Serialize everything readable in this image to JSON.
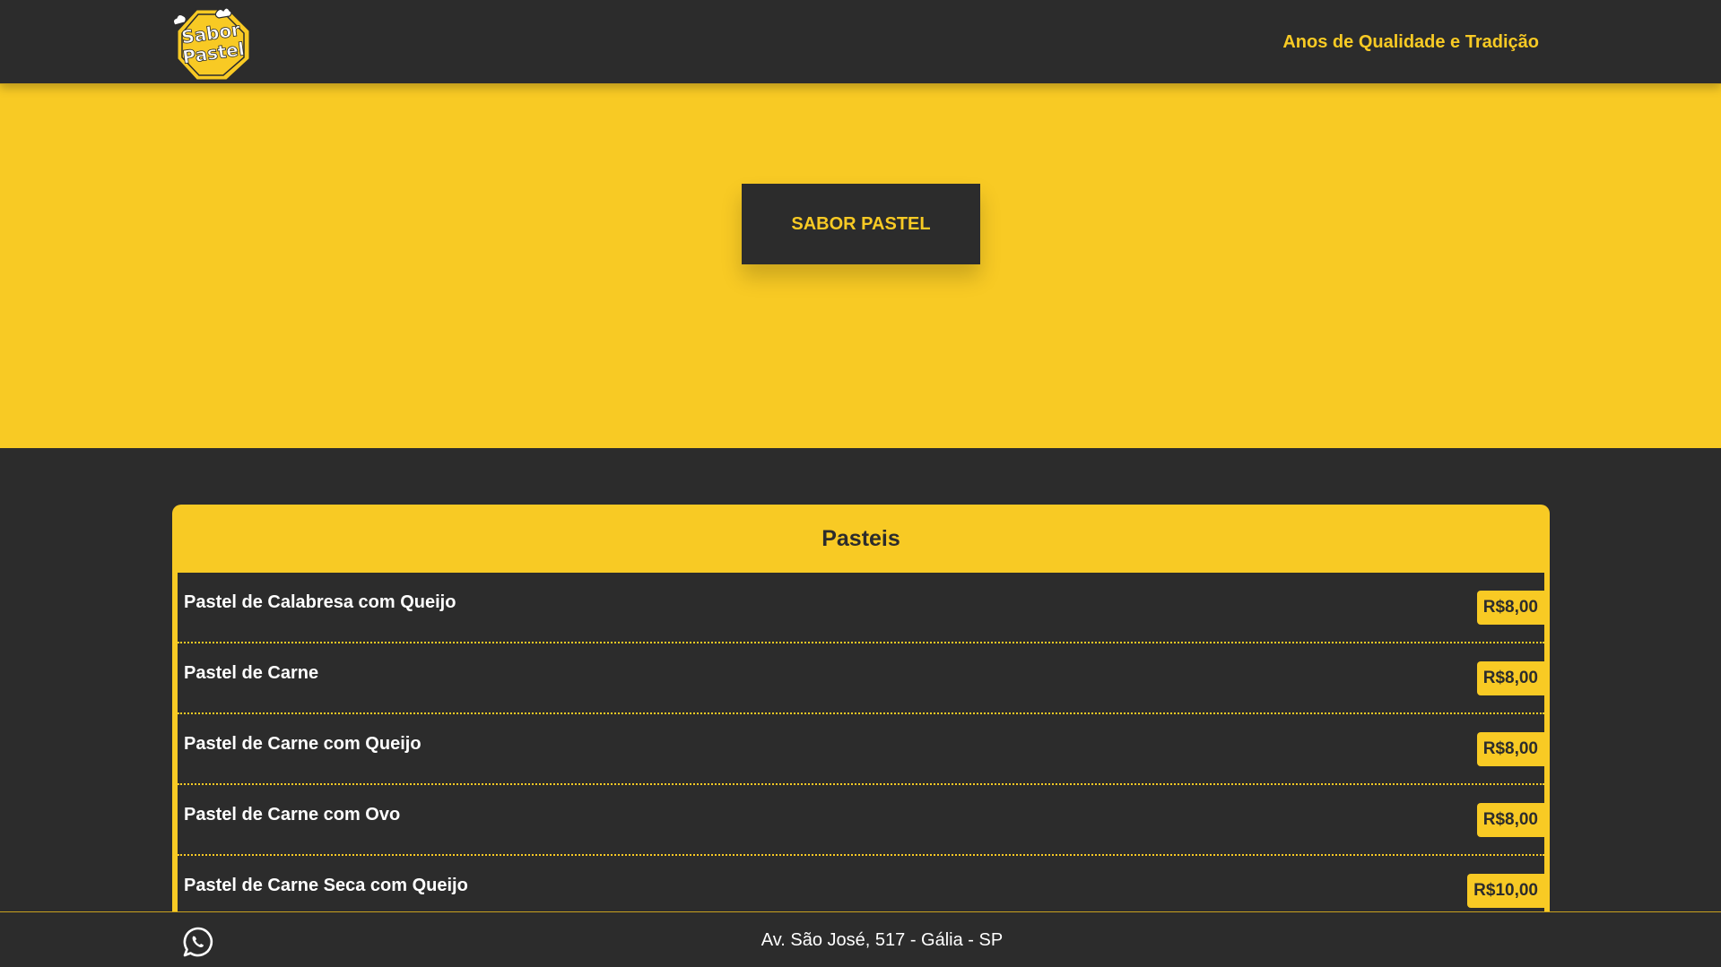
{
  "header": {
    "logo_text": [
      "Sabor",
      "Pastel"
    ],
    "tagline": "Anos de Qualidade e Tradição"
  },
  "hero": {
    "button_label": "SABOR PASTEL"
  },
  "menu": {
    "title": "Pasteis",
    "items": [
      {
        "name": "Pastel de Calabresa com Queijo",
        "price": "R$8,00"
      },
      {
        "name": "Pastel de Carne",
        "price": "R$8,00"
      },
      {
        "name": "Pastel de Carne com Queijo",
        "price": "R$8,00"
      },
      {
        "name": "Pastel de Carne com Ovo",
        "price": "R$8,00"
      },
      {
        "name": "Pastel de Carne Seca com Queijo",
        "price": "R$10,00"
      }
    ]
  },
  "footer": {
    "icon": "whatsapp-icon",
    "address": "Av. São José, 517 - Gália - SP"
  },
  "colors": {
    "primary": "#f8ca24",
    "dark": "#2c2c2c",
    "text_light": "#ffffff"
  }
}
